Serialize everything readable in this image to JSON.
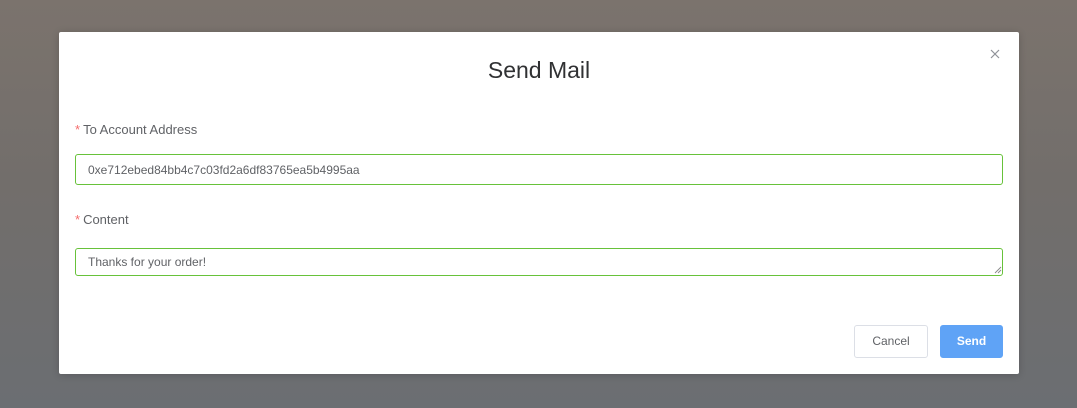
{
  "dialog": {
    "title": "Send Mail",
    "close_icon": "close-icon"
  },
  "form": {
    "to_address": {
      "required_mark": "*",
      "label": "To Account Address",
      "value": "0xe712ebed84bb4c7c03fd2a6df83765ea5b4995aa"
    },
    "content": {
      "required_mark": "*",
      "label": "Content",
      "value": "Thanks for your order!"
    }
  },
  "footer": {
    "cancel_label": "Cancel",
    "send_label": "Send"
  },
  "colors": {
    "required": "#f56c6c",
    "valid_border": "#67c23a",
    "primary": "#5fa3f6"
  }
}
